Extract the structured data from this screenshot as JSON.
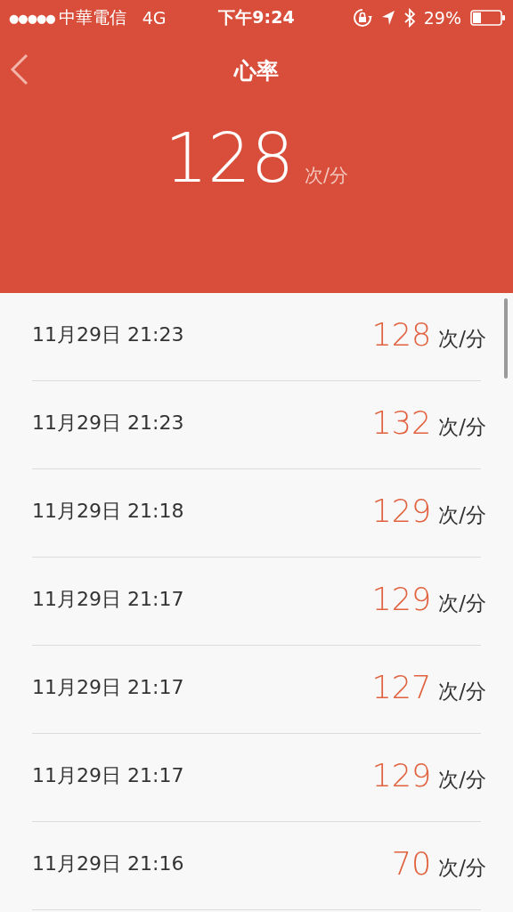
{
  "status_bar": {
    "signal_dots": "●●●●●",
    "carrier": "中華電信",
    "network": "4G",
    "time": "下午9:24",
    "battery_percent": "29%"
  },
  "header": {
    "title": "心率",
    "value": "128",
    "unit": "次/分"
  },
  "records": [
    {
      "time": "11月29日 21:23",
      "value": "128",
      "unit": "次/分"
    },
    {
      "time": "11月29日 21:23",
      "value": "132",
      "unit": "次/分"
    },
    {
      "time": "11月29日 21:18",
      "value": "129",
      "unit": "次/分"
    },
    {
      "time": "11月29日 21:17",
      "value": "129",
      "unit": "次/分"
    },
    {
      "time": "11月29日 21:17",
      "value": "127",
      "unit": "次/分"
    },
    {
      "time": "11月29日 21:17",
      "value": "129",
      "unit": "次/分"
    },
    {
      "time": "11月29日 21:16",
      "value": "70",
      "unit": "次/分"
    }
  ]
}
